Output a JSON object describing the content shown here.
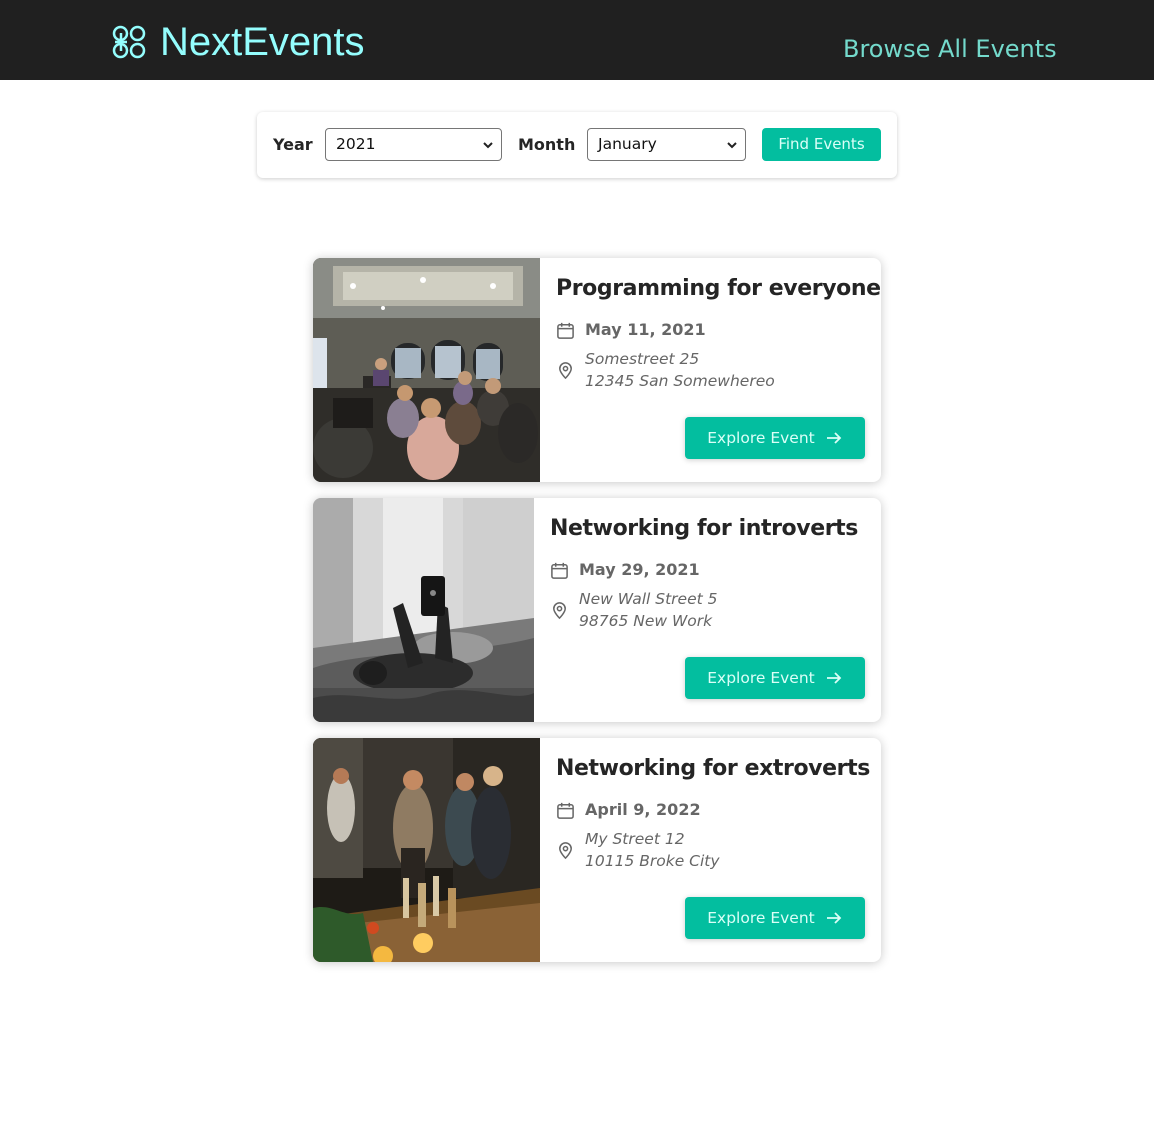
{
  "header": {
    "logo_text": "NextEvents",
    "nav_link": "Browse All Events",
    "logo_icon": "apps-icon"
  },
  "filter": {
    "year_label": "Year",
    "year_value": "2021",
    "month_label": "Month",
    "month_value": "January",
    "submit_label": "Find Events"
  },
  "events": [
    {
      "title": "Programming for everyone",
      "date": "May 11, 2021",
      "address": "Somestreet 25\n12345 San Somewhereo",
      "button": "Explore Event",
      "image": "conference-room-photo"
    },
    {
      "title": "Networking for introverts",
      "date": "May 29, 2021",
      "address": "New Wall Street 5\n98765 New Work",
      "button": "Explore Event",
      "image": "person-with-phone-photo"
    },
    {
      "title": "Networking for extroverts",
      "date": "April 9, 2022",
      "address": "My Street 12\n10115 Broke City",
      "button": "Explore Event",
      "image": "party-photo"
    }
  ],
  "colors": {
    "header_bg": "#202020",
    "logo": "#94fdfd",
    "nav": "#74dacc",
    "accent": "#03be9f",
    "button_text": "#dafff7"
  }
}
